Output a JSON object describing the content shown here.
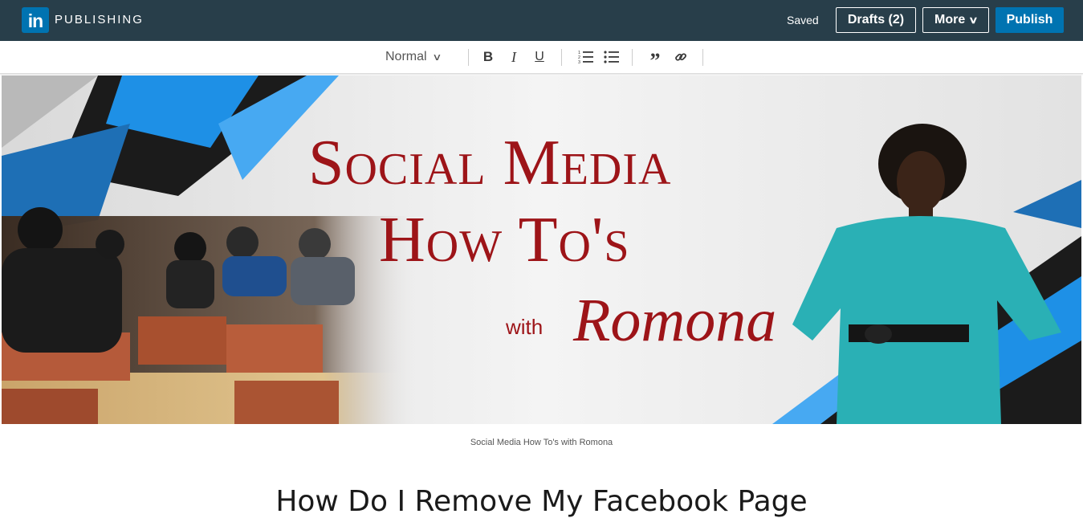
{
  "header": {
    "logo_text": "in",
    "brand": "PUBLISHING",
    "status": "Saved",
    "drafts_label": "Drafts (2)",
    "more_label": "More",
    "publish_label": "Publish"
  },
  "toolbar": {
    "style_select": "Normal",
    "bold": "B",
    "italic": "I",
    "underline": "U",
    "quote": "”"
  },
  "banner": {
    "line1": "Social Media",
    "line2": "How To's",
    "with": "with",
    "name": "Romona",
    "text_color": "#9d1418",
    "accent_blue": "#1e90e6",
    "dress_color": "#2ab0b5"
  },
  "caption": "Social Media How To's with Romona",
  "article": {
    "title": "How Do I Remove My Facebook Page"
  },
  "colors": {
    "topbar": "#283e4a",
    "brand_blue": "#0073b1"
  }
}
